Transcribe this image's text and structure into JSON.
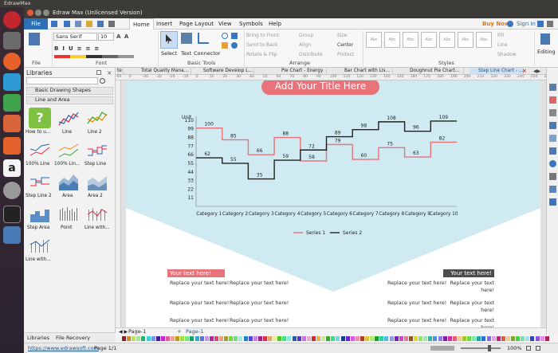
{
  "window": {
    "title": "EdrawMax",
    "subtitle": "Edraw Max (Unlicensed Version)"
  },
  "menu": {
    "file": "File",
    "items": [
      "Home",
      "Insert",
      "Page Layout",
      "View",
      "Symbols",
      "Help"
    ],
    "buy": "Buy Now",
    "signin": "Sign In"
  },
  "ribbon": {
    "font_name": "Sans Serif",
    "font_size": "10",
    "select": "Select",
    "text": "Text",
    "connector": "Connector",
    "bring_front": "Bring to Front",
    "send_back": "Send to Back",
    "rotate": "Rotate & Flip",
    "group": "Group",
    "align": "Align",
    "distribute": "Distribute",
    "size": "Size",
    "center": "Center",
    "protect": "Protect",
    "fill": "Fill",
    "line": "Line",
    "shadow": "Shadow",
    "editing": "Editing",
    "style_box": "Abc",
    "groups": {
      "file": "File",
      "font": "Font",
      "basic_tools": "Basic Tools",
      "arrange": "Arrange",
      "styles": "Styles"
    }
  },
  "library": {
    "title": "Libraries",
    "search_placeholder": "",
    "sections": [
      "Basic Drawing Shapes",
      "Line and Area"
    ],
    "shapes": [
      "How to u...",
      "Line",
      "Line 2",
      "100% Line",
      "100% Lin...",
      "Step Line",
      "Step Line 2",
      "Area",
      "Area 2",
      "Step Area",
      "Point",
      "Line with...",
      "Line with..."
    ],
    "bottom_tabs": [
      "Libraries",
      "File Recovery"
    ]
  },
  "tabs": [
    "te",
    "Total Quality Mana...",
    "Software Develop L...",
    "Pie Chart - Energy",
    "Bar Chart with Lis...",
    "Doughnut Pie Chart...",
    "Step Line Chart - ..."
  ],
  "ruler_labels": [
    "-60",
    "0",
    "-40",
    "-30",
    "-20",
    "-10",
    "0",
    "10",
    "20",
    "30",
    "40",
    "50",
    "60",
    "70",
    "80",
    "90",
    "100",
    "110",
    "120",
    "130",
    "140",
    "150",
    "160",
    "170",
    "180",
    "190",
    "200",
    "210",
    "220",
    "230",
    "240",
    "250",
    "260"
  ],
  "page": {
    "title": "Add Your Title Here",
    "text_here": "Your text here!",
    "replace": "Replace your text here!",
    "colors": {
      "accent": "#e8737b",
      "light_blue": "#cfeaf1",
      "dark_badge": "#4d4d4d"
    }
  },
  "pages": {
    "tab": "Page-1",
    "active": "Page-1"
  },
  "status": {
    "url": "https://www.edrawsoft.com",
    "page": "Page 1/1",
    "zoom": "100%"
  },
  "chart_data": {
    "type": "line",
    "title": "",
    "ylabel": "Unit",
    "xlabel": "",
    "categories": [
      "Category 1",
      "Category 2",
      "Category 3",
      "Category 4",
      "Category 5",
      "Category 6",
      "Category 7",
      "Category 8",
      "Category 9",
      "Category 10"
    ],
    "y_ticks": [
      11,
      22,
      33,
      44,
      55,
      66,
      77,
      88,
      99,
      110
    ],
    "ylim": [
      0,
      115
    ],
    "step": true,
    "series": [
      {
        "name": "Series 1",
        "color": "#e8737b",
        "values": [
          100,
          85,
          66,
          88,
          58,
          79,
          60,
          75,
          63,
          82
        ]
      },
      {
        "name": "Series 2",
        "color": "#222222",
        "values": [
          62,
          55,
          35,
          59,
          72,
          89,
          98,
          108,
          96,
          109
        ]
      }
    ],
    "legend_position": "bottom"
  }
}
